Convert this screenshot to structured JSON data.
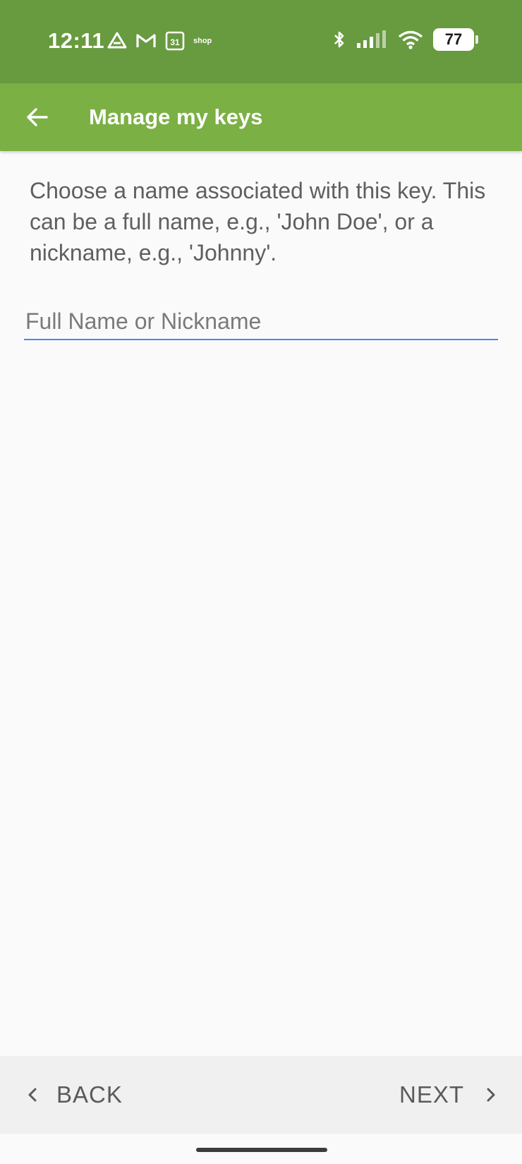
{
  "status_bar": {
    "time": "12:11",
    "battery": "77",
    "left_icons": [
      "drive-icon",
      "gmail-icon",
      "calendar-icon",
      "shop-icon"
    ],
    "calendar_day": "31",
    "shop_label": "shop",
    "right_icons": [
      "bluetooth-icon",
      "signal-icon",
      "wifi-icon",
      "battery-icon"
    ]
  },
  "app_bar": {
    "title": "Manage my keys",
    "back_icon": "arrow-left-icon"
  },
  "main": {
    "description": "Choose a name associated with this key. This can be a full name, e.g., 'John Doe', or a nickname, e.g., 'Johnny'.",
    "name_input": {
      "value": "",
      "placeholder": "Full Name or Nickname"
    }
  },
  "bottom_nav": {
    "back_label": "BACK",
    "next_label": "NEXT"
  },
  "colors": {
    "status_bar": "#689a3f",
    "app_bar": "#7bb045",
    "input_underline": "#3d8ef0",
    "background": "#fafafa",
    "bottom_bar": "#f0f0f0"
  }
}
